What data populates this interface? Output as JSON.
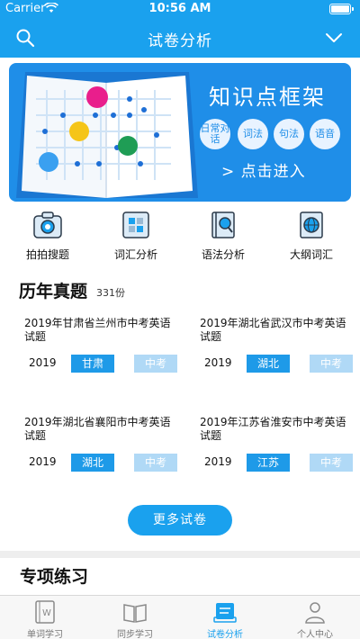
{
  "status_bar": {
    "carrier": "Carrier",
    "time": "10:56 AM"
  },
  "navbar": {
    "title": "试卷分析"
  },
  "banner": {
    "title": "知识点框架",
    "chips": [
      "日常对话",
      "词法",
      "句法",
      "语音"
    ],
    "cta": "> 点击进入"
  },
  "tools": [
    {
      "label": "拍拍搜题",
      "icon": "camera-icon"
    },
    {
      "label": "词汇分析",
      "icon": "grid-book-icon"
    },
    {
      "label": "语法分析",
      "icon": "book-search-icon"
    },
    {
      "label": "大纲词汇",
      "icon": "globe-book-icon"
    }
  ],
  "past_exams": {
    "title": "历年真题",
    "count": "331份",
    "items": [
      {
        "name": "2019年甘肃省兰州市中考英语试题",
        "year": "2019",
        "region": "甘肃",
        "level": "中考"
      },
      {
        "name": "2019年湖北省武汉市中考英语试题",
        "year": "2019",
        "region": "湖北",
        "level": "中考"
      },
      {
        "name": "2019年湖北省襄阳市中考英语试题",
        "year": "2019",
        "region": "湖北",
        "level": "中考"
      },
      {
        "name": "2019年江苏省淮安市中考英语试题",
        "year": "2019",
        "region": "江苏",
        "level": "中考"
      }
    ],
    "more_label": "更多试卷"
  },
  "special_practice": {
    "title": "专项练习"
  },
  "tabbar": {
    "items": [
      {
        "label": "单词学习",
        "icon": "word-card-icon"
      },
      {
        "label": "同步学习",
        "icon": "open-book-icon"
      },
      {
        "label": "试卷分析",
        "icon": "paper-stack-icon"
      },
      {
        "label": "个人中心",
        "icon": "person-icon"
      }
    ],
    "active": 2,
    "accent": "#1aa1ee",
    "inactive": "#777777"
  },
  "colors": {
    "primary": "#1aa1ee",
    "banner": "#1f8ee8",
    "tag_active": "#1e9ae8",
    "tag_muted": "#b0d9f6"
  }
}
